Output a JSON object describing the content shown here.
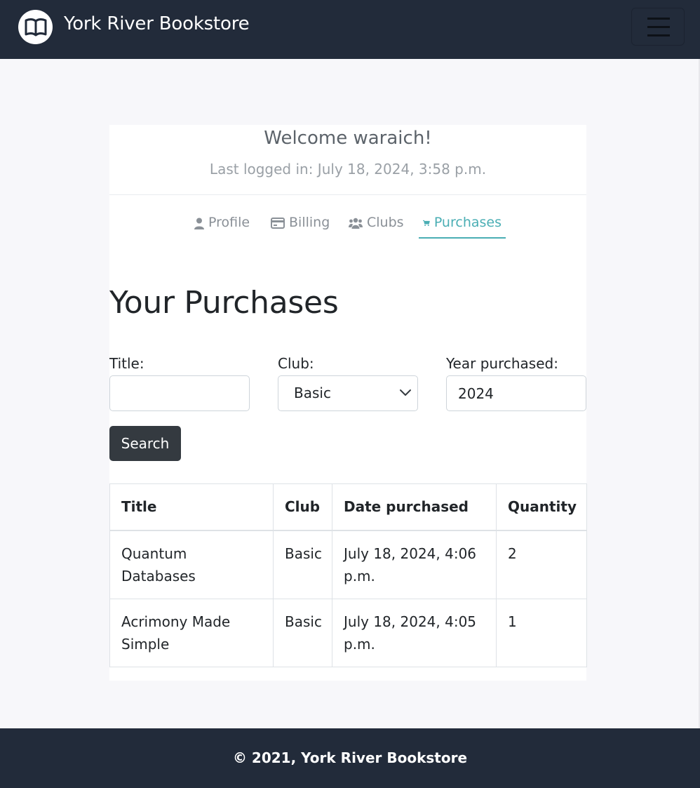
{
  "app": {
    "brand_name": "York River Bookstore",
    "logo_icon": "open-book-icon",
    "menu_icon": "hamburger-menu-icon"
  },
  "profile_header": {
    "welcome": "Welcome waraich!",
    "last_login": "Last logged in: July 18, 2024, 3:58 p.m."
  },
  "tabs": [
    {
      "label": "Profile",
      "icon": "user-icon",
      "active": false
    },
    {
      "label": "Billing",
      "icon": "credit-card-icon",
      "active": false
    },
    {
      "label": "Clubs",
      "icon": "users-icon",
      "active": false
    },
    {
      "label": "Purchases",
      "icon": "shopping-cart-icon",
      "active": true
    }
  ],
  "main": {
    "title": "Your Purchases",
    "filters": {
      "title_label": "Title:",
      "title_value": "",
      "club_label": "Club:",
      "club_selected": "Basic",
      "year_label": "Year purchased:",
      "year_value": "2024"
    },
    "search_label": "Search"
  },
  "table": {
    "headers": [
      "Title",
      "Club",
      "Date purchased",
      "Quantity"
    ],
    "rows": [
      [
        "Quantum Databases",
        "Basic",
        "July 18, 2024, 4:06 p.m.",
        "2"
      ],
      [
        "Acrimony Made Simple",
        "Basic",
        "July 18, 2024, 4:05 p.m.",
        "1"
      ]
    ]
  },
  "footer": {
    "text": "© 2021, York River Bookstore"
  },
  "colors": {
    "navbar": "#222b3a",
    "accent": "#4aaeb4",
    "button_dark": "#343a40"
  }
}
